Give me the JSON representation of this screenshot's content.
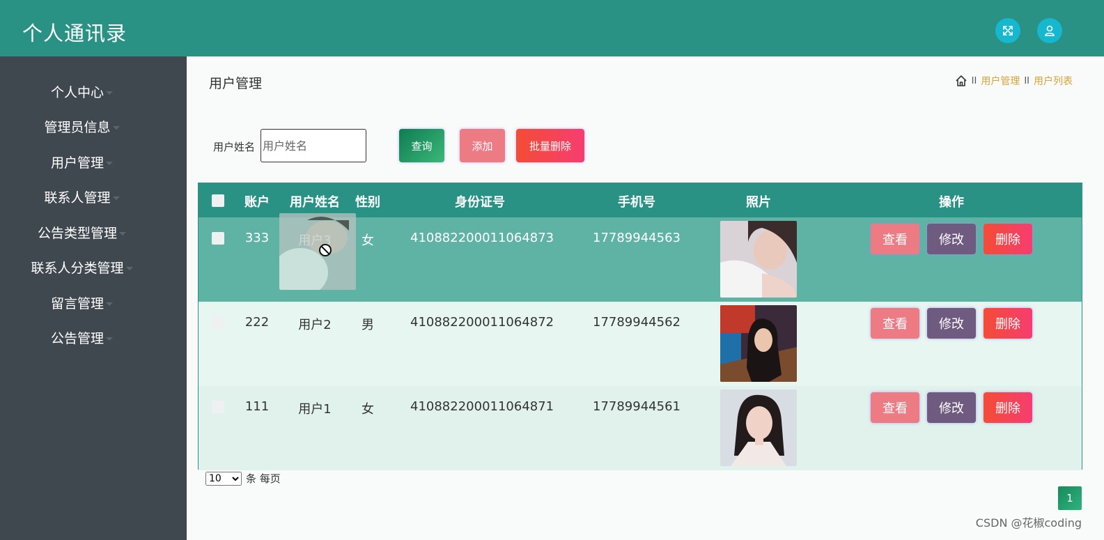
{
  "app": {
    "title": "个人通讯录"
  },
  "header_icons": [
    "fullscreen-icon",
    "user-icon"
  ],
  "sidebar": {
    "items": [
      {
        "label": "个人中心"
      },
      {
        "label": "管理员信息"
      },
      {
        "label": "用户管理"
      },
      {
        "label": "联系人管理"
      },
      {
        "label": "公告类型管理"
      },
      {
        "label": "联系人分类管理"
      },
      {
        "label": "留言管理"
      },
      {
        "label": "公告管理"
      }
    ]
  },
  "page": {
    "title": "用户管理",
    "breadcrumb": {
      "sep": "II",
      "items": [
        "用户管理",
        "用户列表"
      ]
    }
  },
  "search": {
    "label": "用户姓名",
    "placeholder": "用户姓名",
    "query_label": "查询",
    "add_label": "添加",
    "batch_delete_label": "批量删除"
  },
  "table": {
    "columns": [
      "账户",
      "用户姓名",
      "性别",
      "身份证号",
      "手机号",
      "照片",
      "操作"
    ],
    "rows": [
      {
        "account": "333",
        "name": "用户3",
        "gender": "女",
        "id_number": "410882200011064873",
        "phone": "17789944563",
        "selected": true
      },
      {
        "account": "222",
        "name": "用户2",
        "gender": "男",
        "id_number": "410882200011064872",
        "phone": "17789944562",
        "selected": false
      },
      {
        "account": "111",
        "name": "用户1",
        "gender": "女",
        "id_number": "410882200011064871",
        "phone": "17789944561",
        "selected": false
      }
    ],
    "actions": {
      "view": "查看",
      "edit": "修改",
      "delete": "删除"
    }
  },
  "pagination": {
    "page_size": "10",
    "page_size_suffix": "条 每页",
    "current_page": "1"
  },
  "watermark": "CSDN @花椒coding",
  "colors": {
    "header": "#2a9284",
    "sidebar": "#40484f",
    "row_selected": "#5fb3a4",
    "row_even": "#e7f6f0",
    "row_odd": "#e1f2ec",
    "view_button": "#ec7b84",
    "edit_button": "#705b80",
    "delete_button": "#f04b5a",
    "breadcrumb": "#d9a33a"
  }
}
